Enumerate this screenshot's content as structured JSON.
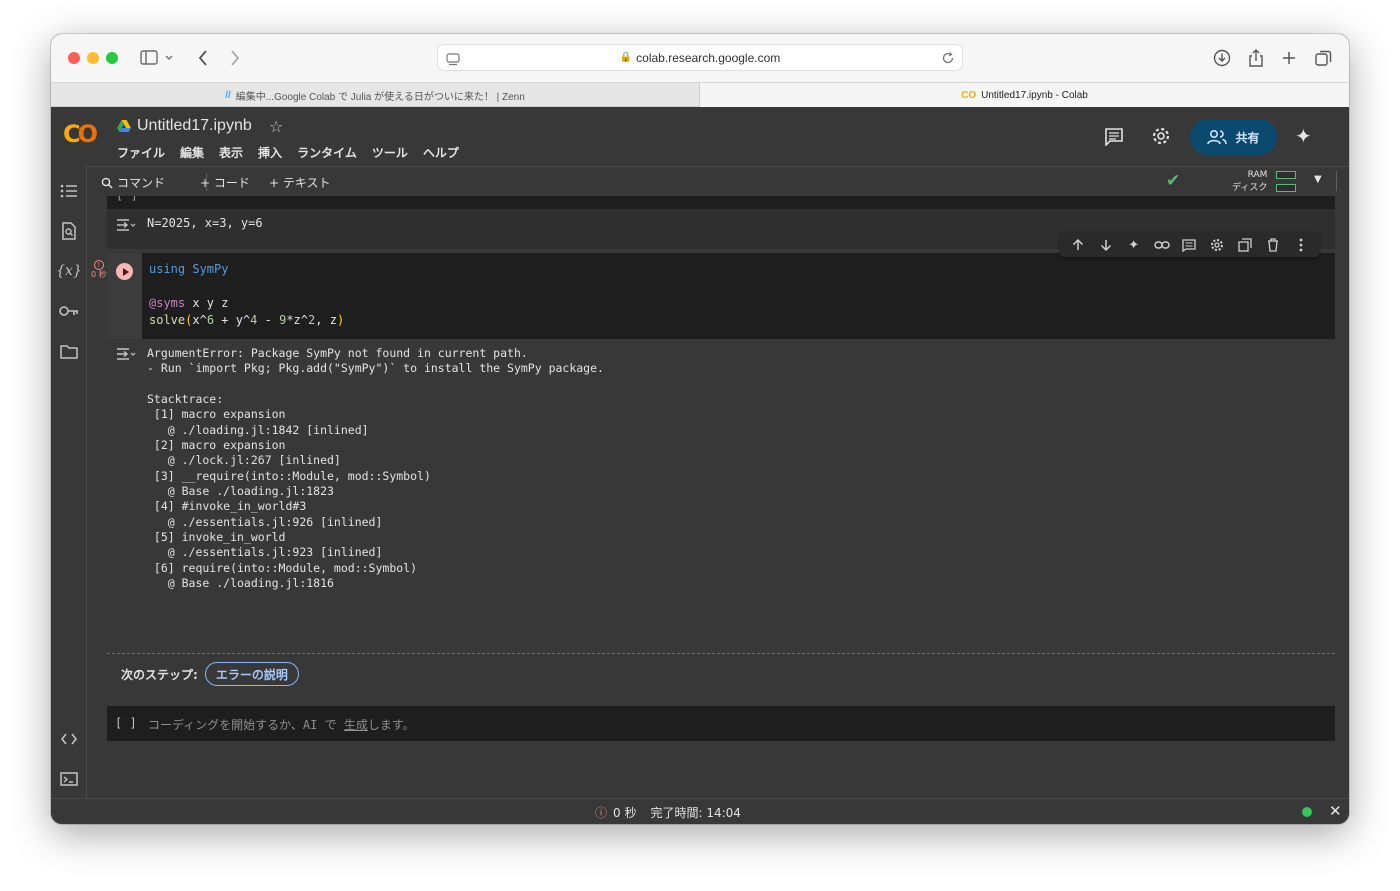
{
  "browser": {
    "url": "colab.research.google.com",
    "tabs": [
      {
        "label": "編集中...Google Colab で Julia が使える日がついに来た！ | Zenn",
        "active": false
      },
      {
        "label": "Untitled17.ipynb - Colab",
        "active": true
      }
    ]
  },
  "header": {
    "logo": "CO",
    "notebook_title": "Untitled17.ipynb",
    "menu": [
      "ファイル",
      "編集",
      "表示",
      "挿入",
      "ランタイム",
      "ツール",
      "ヘルプ"
    ],
    "share_label": "共有"
  },
  "toolbar": {
    "command_label": "コマンド",
    "add_code_label": "+ コード",
    "add_text_label": "+ テキスト",
    "ram_label": "RAM",
    "disk_label": "ディスク"
  },
  "cells": {
    "prev_output": "N=2025, x=3, y=6",
    "prev_bracket": "[ ]",
    "error_time": "0 秒",
    "code_lines": [
      "using SymPy",
      "",
      "@syms x y z",
      "solve(x^6 + y^4 - 9*z^2, z)"
    ],
    "output_lines": [
      "ArgumentError: Package SymPy not found in current path.",
      "- Run `import Pkg; Pkg.add(\"SymPy\")` to install the SymPy package.",
      "",
      "Stacktrace:",
      " [1] macro expansion",
      "   @ ./loading.jl:1842 [inlined]",
      " [2] macro expansion",
      "   @ ./lock.jl:267 [inlined]",
      " [3] __require(into::Module, mod::Symbol)",
      "   @ Base ./loading.jl:1823",
      " [4] #invoke_in_world#3",
      "   @ ./essentials.jl:926 [inlined]",
      " [5] invoke_in_world",
      "   @ ./essentials.jl:923 [inlined]",
      " [6] require(into::Module, mod::Symbol)",
      "   @ Base ./loading.jl:1816"
    ],
    "next_steps_label": "次のステップ:",
    "explain_error_label": "エラーの説明",
    "empty_bracket": "[ ]",
    "placeholder_prefix": "コーディングを開始するか、AI で",
    "placeholder_link": "生成",
    "placeholder_suffix": "します。"
  },
  "status": {
    "elapsed": "0 秒",
    "completed": "完了時間: 14:04"
  },
  "colors": {
    "accent": "#0b4a6f",
    "error": "#f28b82",
    "ok": "#34c759"
  }
}
